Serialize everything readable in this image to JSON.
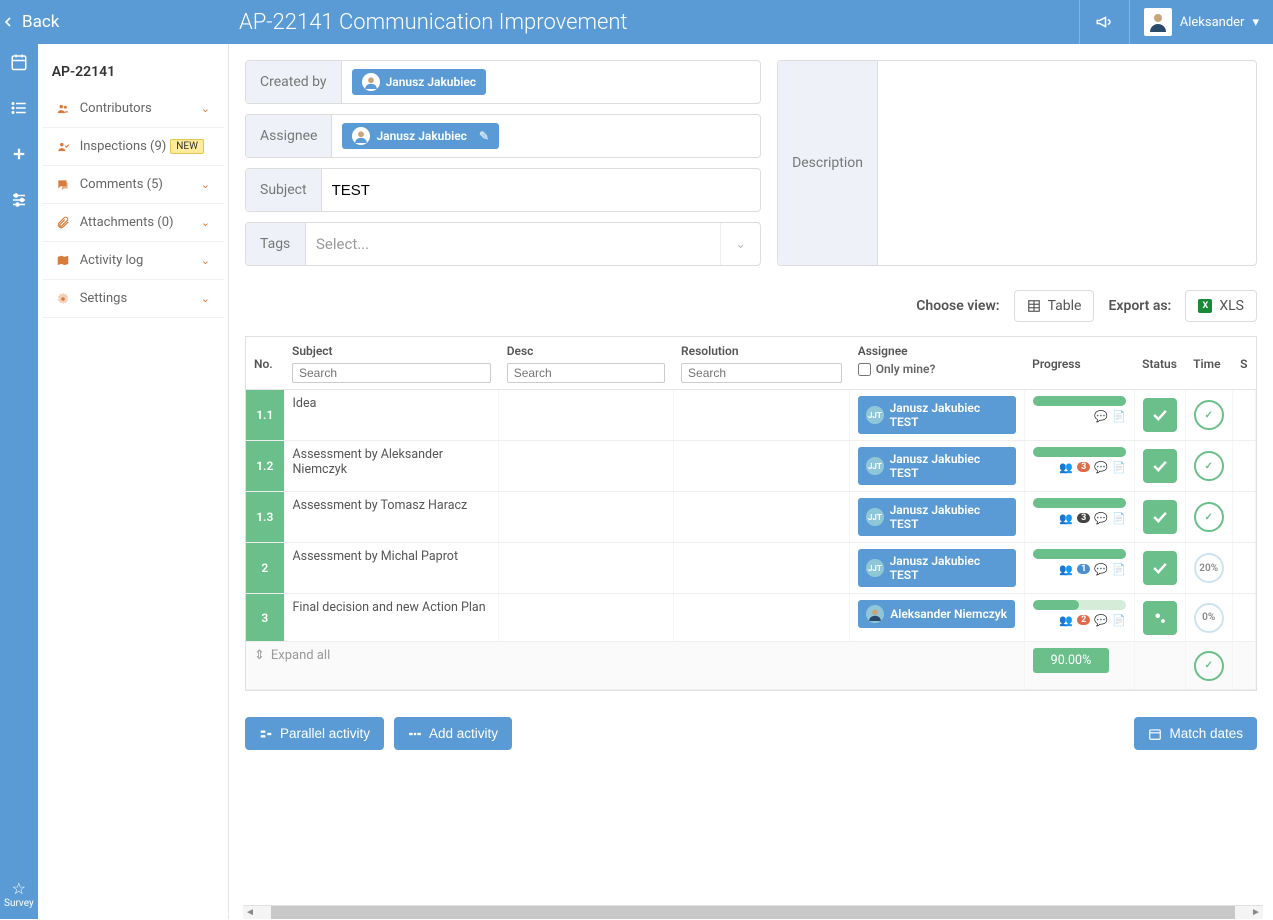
{
  "header": {
    "back": "Back",
    "title": "AP-22141 Communication Improvement",
    "user": "Aleksander"
  },
  "sidebar": {
    "code": "AP-22141",
    "items": [
      {
        "label": "Contributors",
        "icon": "users"
      },
      {
        "label": "Inspections (9)",
        "icon": "usercheck",
        "badge": "NEW"
      },
      {
        "label": "Comments (5)",
        "icon": "comments"
      },
      {
        "label": "Attachments (0)",
        "icon": "attach"
      },
      {
        "label": "Activity log",
        "icon": "map"
      },
      {
        "label": "Settings",
        "icon": "gear"
      }
    ]
  },
  "form": {
    "created_by_label": "Created by",
    "created_by": "Janusz Jakubiec",
    "assignee_label": "Assignee",
    "assignee": "Janusz Jakubiec",
    "subject_label": "Subject",
    "subject": "TEST",
    "tags_label": "Tags",
    "tags_placeholder": "Select...",
    "desc_label": "Description"
  },
  "view": {
    "choose": "Choose view:",
    "table": "Table",
    "export": "Export as:",
    "xls": "XLS"
  },
  "table": {
    "cols": {
      "no": "No.",
      "subject": "Subject",
      "desc": "Desc",
      "resolution": "Resolution",
      "assignee": "Assignee",
      "progress": "Progress",
      "status": "Status",
      "time": "Time",
      "s": "S"
    },
    "search": "Search",
    "only_mine": "Only mine?",
    "rows": [
      {
        "no": "1.1",
        "subject": "Idea",
        "assignee": "Janusz Jakubiec TEST",
        "avatar": "JJT",
        "progress": 100,
        "status": "check",
        "time": "check",
        "icons": []
      },
      {
        "no": "1.2",
        "subject": "Assessment by Aleksander Niemczyk",
        "assignee": "Janusz Jakubiec TEST",
        "avatar": "JJT",
        "progress": 100,
        "status": "check",
        "time": "check",
        "icons": [
          "users",
          "badge:3",
          "chat",
          "doc"
        ]
      },
      {
        "no": "1.3",
        "subject": "Assessment by Tomasz Haracz",
        "assignee": "Janusz Jakubiec TEST",
        "avatar": "JJT",
        "progress": 100,
        "status": "check",
        "time": "check",
        "icons": [
          "users",
          "badge-dark:3",
          "chat",
          "doc"
        ]
      },
      {
        "no": "2",
        "subject": "Assessment by Michal Paprot",
        "assignee": "Janusz Jakubiec TEST",
        "avatar": "JJT",
        "progress": 100,
        "status": "check",
        "time": "20%",
        "icons": [
          "users",
          "badge-blue:1",
          "chat",
          "doc"
        ]
      },
      {
        "no": "3",
        "subject": "Final decision and new Action Plan",
        "assignee": "Aleksander Niemczyk",
        "avatar": "photo",
        "progress": 50,
        "status": "gear",
        "time": "0%",
        "icons": [
          "users",
          "badge:2",
          "chat",
          "doc"
        ]
      }
    ],
    "expand": "Expand all",
    "total_progress": "90.00%"
  },
  "buttons": {
    "parallel": "Parallel activity",
    "add": "Add activity",
    "match": "Match dates"
  },
  "survey": "Survey"
}
